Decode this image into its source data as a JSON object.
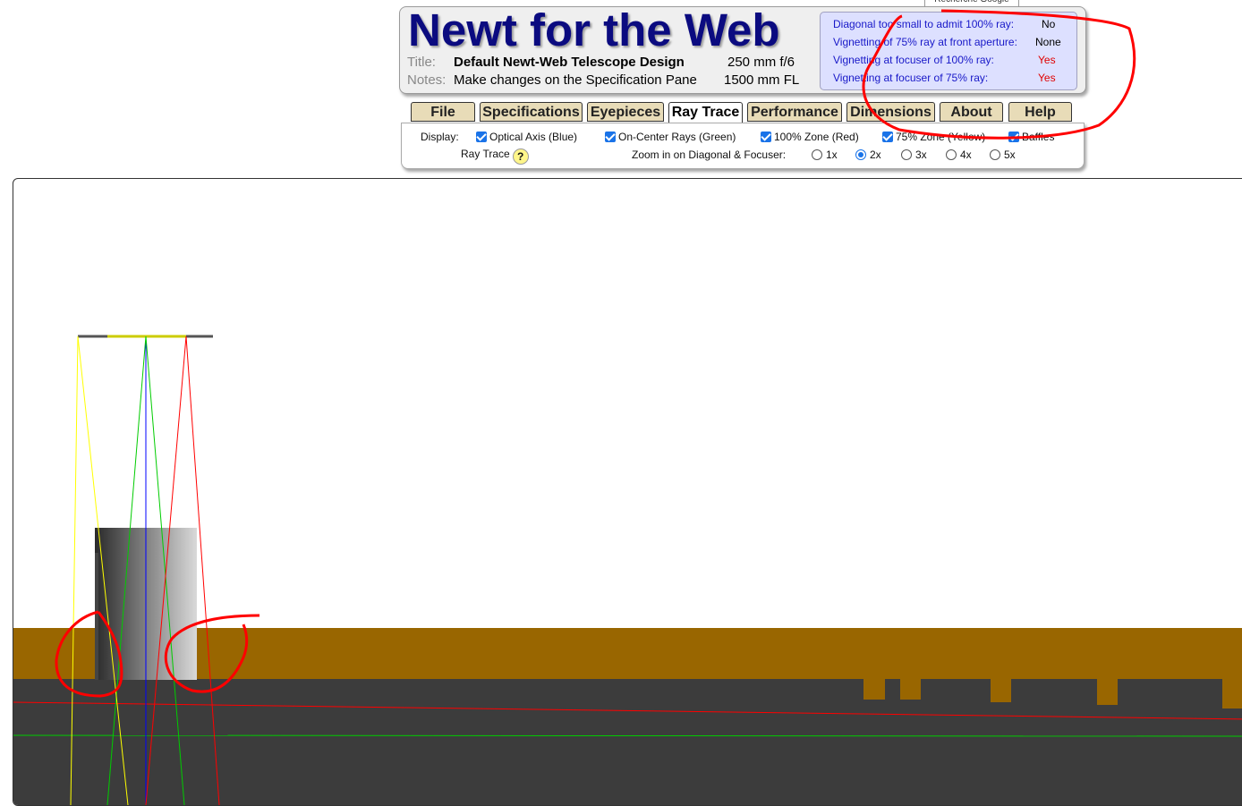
{
  "tooltip": "Recherche Google",
  "header": {
    "app_title": "Newt for the Web",
    "title_label": "Title:",
    "title_value": "Default Newt-Web Telescope Design",
    "aperture": "250 mm f/6",
    "notes_label": "Notes:",
    "notes_value": "Make changes on the Specification Pane",
    "focal_length": "1500 mm FL"
  },
  "warnings": [
    {
      "label": "Diagonal too small to admit 100% ray:",
      "value": "No",
      "alert": false
    },
    {
      "label": "Vignetting of 75% ray at front aperture:",
      "value": "None",
      "alert": false
    },
    {
      "label": "Vignetting at focuser of 100% ray:",
      "value": "Yes",
      "alert": true
    },
    {
      "label": "Vignetting at focuser of  75% ray:",
      "value": "Yes",
      "alert": true
    }
  ],
  "tabs": [
    "File",
    "Specifications",
    "Eyepieces",
    "Ray Trace",
    "Performance",
    "Dimensions",
    "About",
    "Help"
  ],
  "active_tab": "Ray Trace",
  "display": {
    "label": "Display:",
    "options": [
      {
        "label": "Optical Axis (Blue)",
        "checked": true
      },
      {
        "label": "On-Center Rays (Green)",
        "checked": true
      },
      {
        "label": "100% Zone (Red)",
        "checked": true
      },
      {
        "label": "75% Zone (Yellow)",
        "checked": true
      },
      {
        "label": "Baffles",
        "checked": true
      }
    ]
  },
  "ray_trace_label": "Ray Trace",
  "help_symbol": "?",
  "zoom": {
    "label": "Zoom in on Diagonal & Focuser:",
    "options": [
      "1x",
      "2x",
      "3x",
      "4x",
      "5x"
    ],
    "selected": "2x"
  },
  "colors": {
    "title": "#0b0b80",
    "warning_text": "#1818c8",
    "alert": "#e00000",
    "tube": "#996600",
    "tube_inner": "#3c3c3c",
    "axis_ray": "#0000ff",
    "center_ray": "#00cc00",
    "zone100_ray": "#ff0000",
    "zone75_ray": "#ffff00",
    "annotation": "#ff0000"
  },
  "icons": {
    "checkbox": "checkbox-checked-icon",
    "help": "help-icon",
    "radio": "radio-icon"
  }
}
